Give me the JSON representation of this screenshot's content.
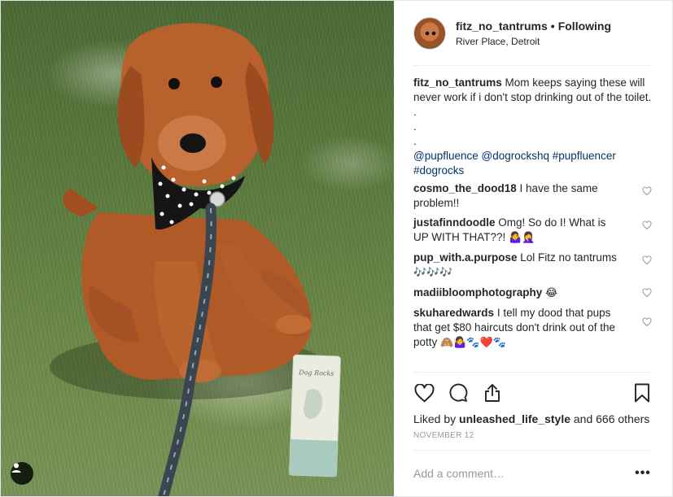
{
  "post": {
    "username": "fitz_no_tantrums",
    "separator": "•",
    "follow_label": "Following",
    "location": "River Place, Detroit"
  },
  "caption": {
    "username": "fitz_no_tantrums",
    "text": "Mom keeps saying these will never work if i don't stop drinking out of the toilet.",
    "dots": [
      ".",
      ".",
      "."
    ],
    "mentions": "@pupfluence @dogrockshq #pupfluencer #dogrocks"
  },
  "comments": [
    {
      "username": "cosmo_the_dood18",
      "text": "I have the same problem!!",
      "emoji": ""
    },
    {
      "username": "justafinndoodle",
      "text": "Omg! So do I! What is UP WITH THAT??!",
      "emoji": "🤷‍♀️🤦‍♀️"
    },
    {
      "username": "pup_with.a.purpose",
      "text": "Lol Fitz no tantrums",
      "emoji": "🎶🎶🎶"
    },
    {
      "username": "madiibloomphotography",
      "text": "",
      "emoji": "😂"
    },
    {
      "username": "skuharedwards",
      "text": "I tell my dood that pups that get $80 haircuts don't drink out of the potty",
      "emoji": "🙈🤷‍♀️🐾❤️🐾"
    }
  ],
  "likes": {
    "prefix": "Liked by",
    "user": "unleashed_life_style",
    "suffix": "and 666 others"
  },
  "date": "NOVEMBER 12",
  "add_comment": {
    "placeholder": "Add a comment…"
  },
  "more_label": "•••",
  "photo": {
    "packet_label": "Dog Rocks",
    "leash_text": "DETROIT"
  },
  "colors": {
    "link": "#003569",
    "muted": "#999999",
    "border": "#efefef",
    "text": "#262626"
  },
  "icons": [
    "heart-icon",
    "comment-icon",
    "share-icon",
    "bookmark-icon",
    "user-tag-icon",
    "more-icon"
  ]
}
